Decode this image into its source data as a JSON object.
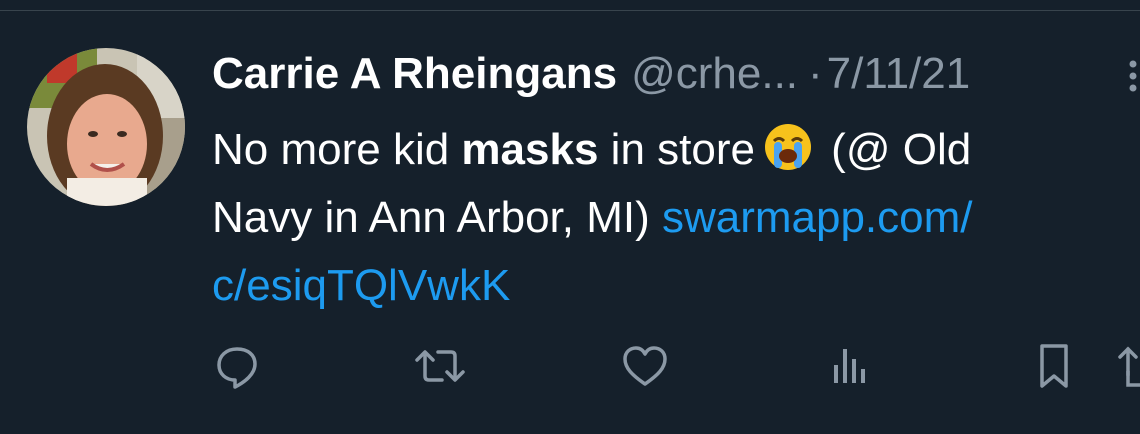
{
  "tweet": {
    "display_name": "Carrie A Rheingans",
    "handle": "@crhe...",
    "separator": "·",
    "date": "7/11/21",
    "text": {
      "part1": "No more kid ",
      "bold": "masks",
      "part2": " in store",
      "emoji": "loudly-crying-face",
      "part3": " (@ Old",
      "line2": "Navy in Ann Arbor, MI) ",
      "link_part1": "swarmapp.com/",
      "link_part2": "c/esiqTQlVwkK"
    }
  },
  "actions": [
    {
      "name": "reply",
      "icon": "reply-icon"
    },
    {
      "name": "retweet",
      "icon": "retweet-icon"
    },
    {
      "name": "like",
      "icon": "heart-icon"
    },
    {
      "name": "views",
      "icon": "analytics-icon"
    },
    {
      "name": "bookmark",
      "icon": "bookmark-icon"
    },
    {
      "name": "share",
      "icon": "share-icon"
    }
  ],
  "colors": {
    "background": "#15202b",
    "text": "#ffffff",
    "secondary": "#8b98a5",
    "link": "#1d9bf0",
    "divider": "#38444d"
  }
}
